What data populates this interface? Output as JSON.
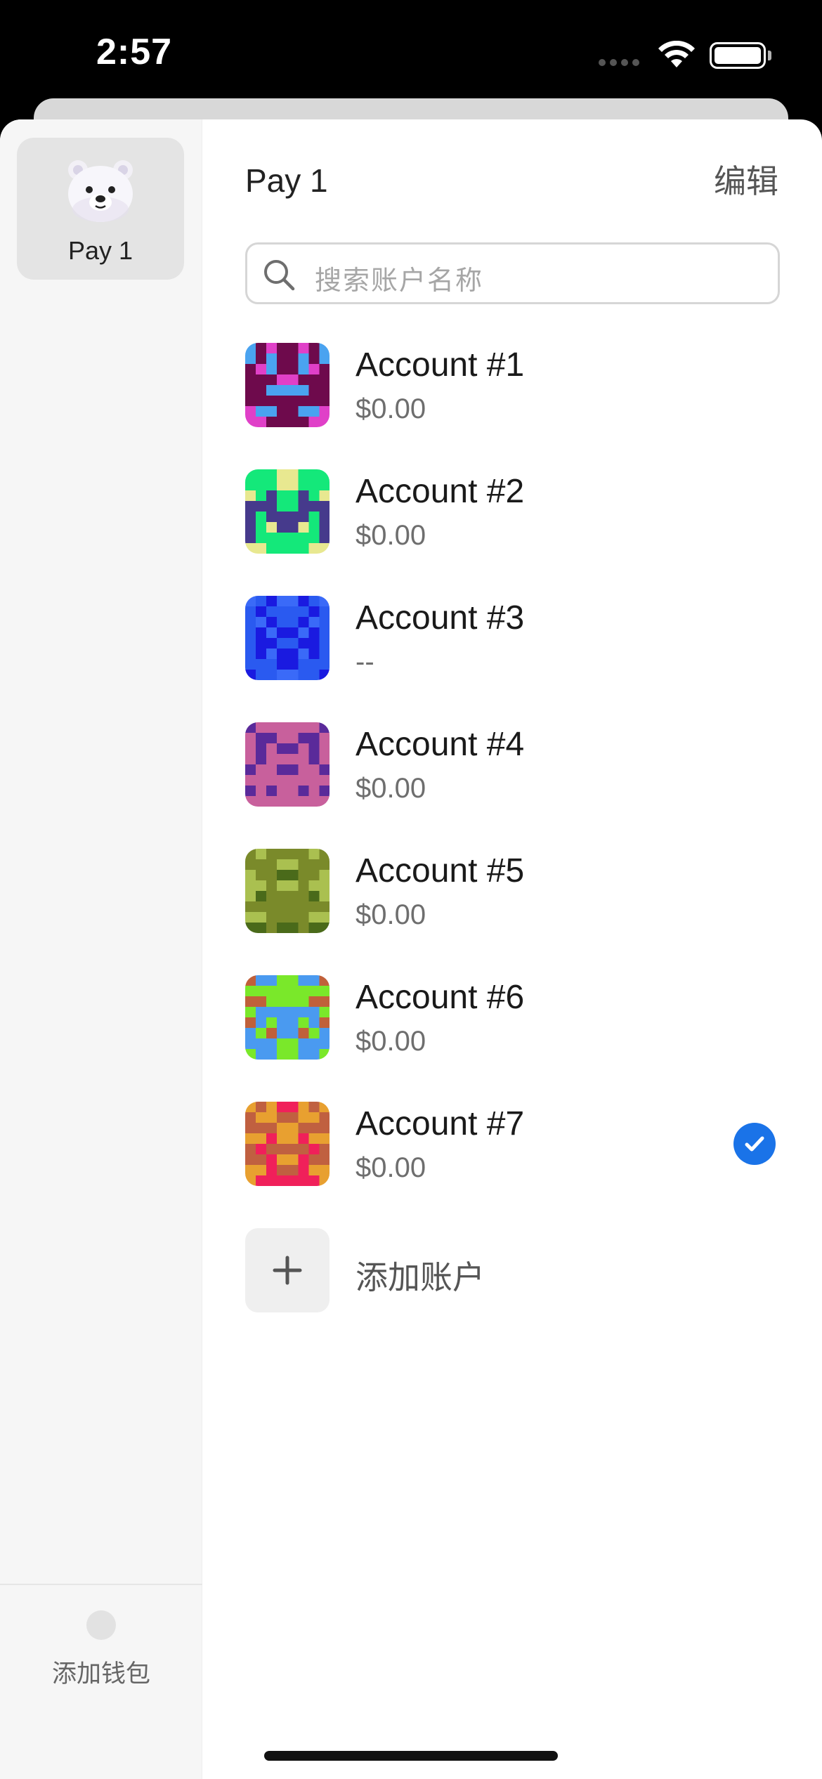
{
  "status_bar": {
    "time": "2:57"
  },
  "sidebar": {
    "wallets": [
      {
        "name": "Pay 1",
        "icon": "polar-bear-icon"
      }
    ],
    "add_wallet_label": "添加钱包"
  },
  "main": {
    "title": "Pay 1",
    "edit_label": "编辑",
    "search": {
      "placeholder": "搜索账户名称"
    },
    "accounts": [
      {
        "name": "Account #1",
        "balance": "$0.00",
        "selected": false,
        "colors": [
          "#6e0a4c",
          "#4aa3f0",
          "#e040c8"
        ]
      },
      {
        "name": "Account #2",
        "balance": "$0.00",
        "selected": false,
        "colors": [
          "#14e87a",
          "#463a8c",
          "#e8e890"
        ]
      },
      {
        "name": "Account #3",
        "balance": "--",
        "selected": false,
        "colors": [
          "#2a5af0",
          "#1a1ae0",
          "#3a6af8"
        ]
      },
      {
        "name": "Account #4",
        "balance": "$0.00",
        "selected": false,
        "colors": [
          "#c8609c",
          "#5a2a9a",
          "#6a7a1a"
        ]
      },
      {
        "name": "Account #5",
        "balance": "$0.00",
        "selected": false,
        "colors": [
          "#7a8a2a",
          "#aac050",
          "#4a6a1a"
        ]
      },
      {
        "name": "Account #6",
        "balance": "$0.00",
        "selected": false,
        "colors": [
          "#7ae82a",
          "#4a9af0",
          "#c0603a"
        ]
      },
      {
        "name": "Account #7",
        "balance": "$0.00",
        "selected": true,
        "colors": [
          "#c06040",
          "#e8a030",
          "#f0205a"
        ]
      }
    ],
    "add_account_label": "添加账户"
  },
  "colors": {
    "accent": "#1a73e8"
  }
}
